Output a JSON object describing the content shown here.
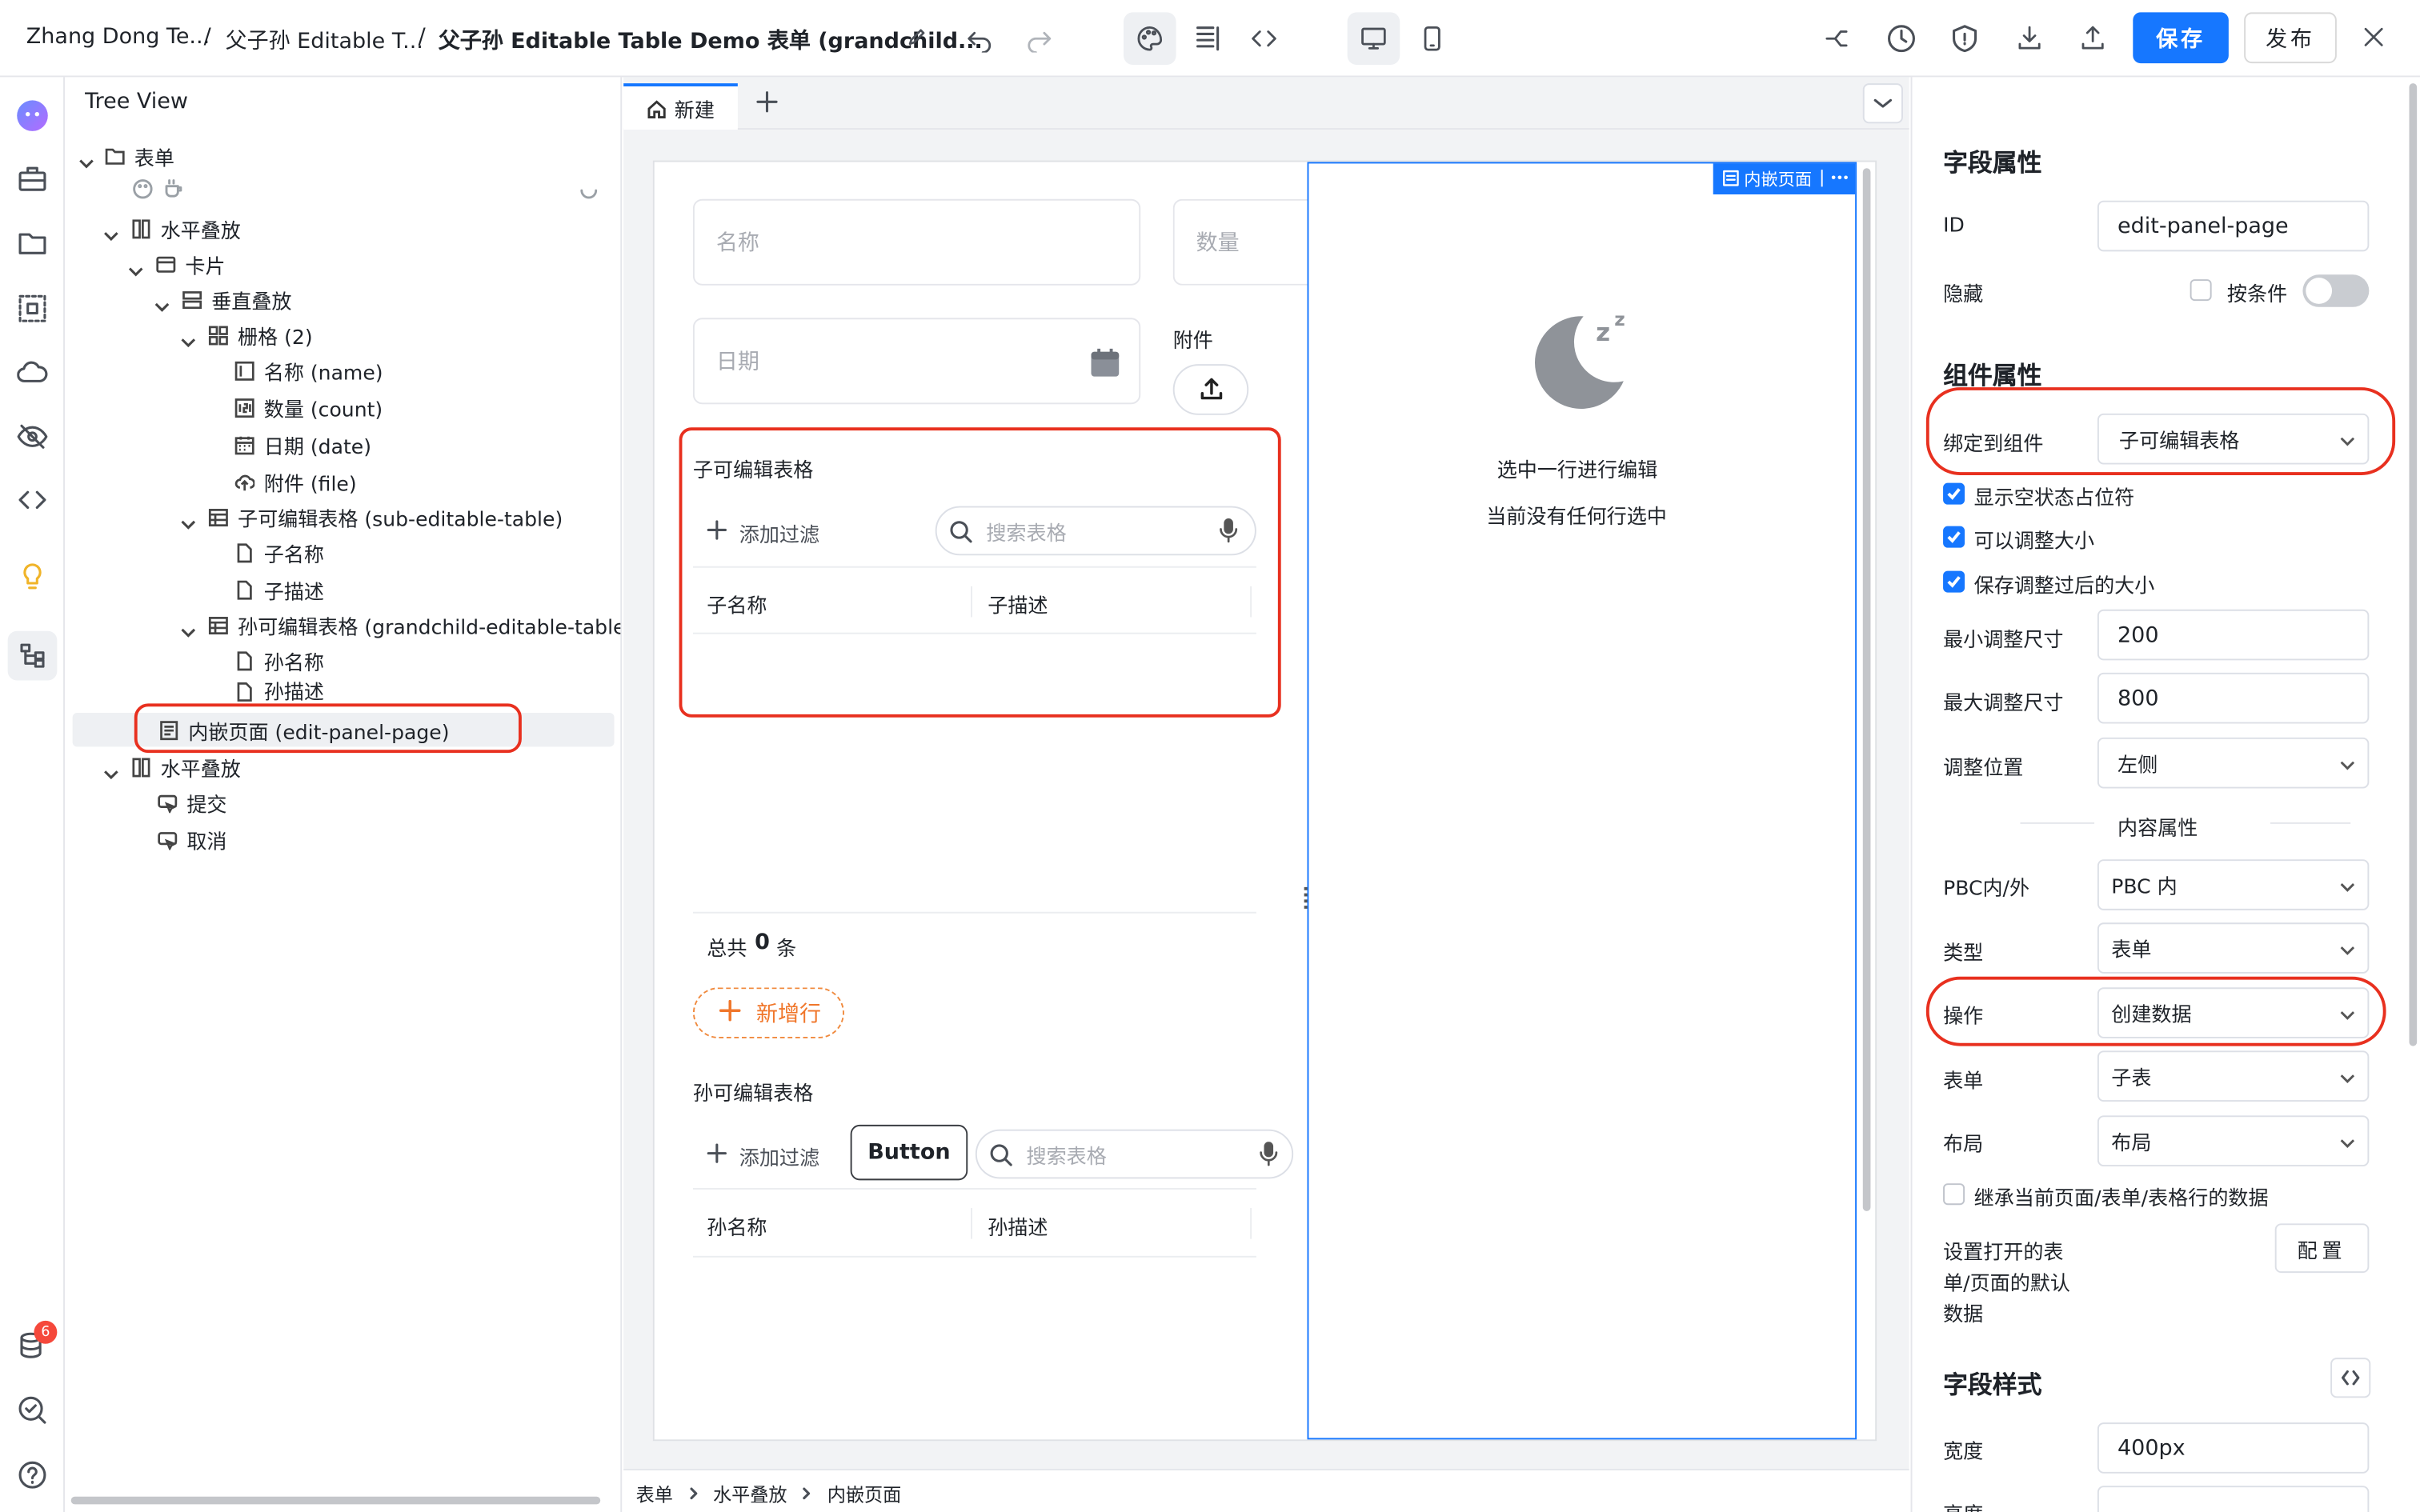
{
  "header": {
    "breadcrumbs": [
      "Zhang Dong Te...",
      "父子孙 Editable T...",
      "父子孙 Editable Table Demo 表单 (grandchild..."
    ],
    "separator": "/",
    "save_label": "保存",
    "publish_label": "发布"
  },
  "rail": {
    "badge_count": "6"
  },
  "tree": {
    "title": "Tree View",
    "nodes": [
      {
        "label": "表单",
        "icon": "folder-icon"
      },
      {
        "label": "水平叠放",
        "icon": "columns-icon"
      },
      {
        "label": "卡片",
        "icon": "card-icon"
      },
      {
        "label": "垂直叠放",
        "icon": "rows-icon"
      },
      {
        "label": "栅格 (2)",
        "icon": "grid-icon"
      },
      {
        "label": "名称 (name)",
        "icon": "text-field-icon"
      },
      {
        "label": "数量 (count)",
        "icon": "number-field-icon"
      },
      {
        "label": "日期 (date)",
        "icon": "calendar-icon"
      },
      {
        "label": "附件 (file)",
        "icon": "upload-cloud-icon"
      },
      {
        "label": "子可编辑表格 (sub-editable-table)",
        "icon": "table-icon"
      },
      {
        "label": "子名称",
        "icon": "file-icon"
      },
      {
        "label": "子描述",
        "icon": "file-icon"
      },
      {
        "label": "孙可编辑表格 (grandchild-editable-table)",
        "icon": "table-icon"
      },
      {
        "label": "孙名称",
        "icon": "file-icon"
      },
      {
        "label": "孙描述",
        "icon": "file-icon"
      },
      {
        "label": "内嵌页面 (edit-panel-page)",
        "icon": "page-icon"
      },
      {
        "label": "水平叠放",
        "icon": "columns-icon"
      },
      {
        "label": "提交",
        "icon": "button-icon"
      },
      {
        "label": "取消",
        "icon": "button-icon"
      }
    ]
  },
  "canvas": {
    "tab_label": "新建",
    "name_placeholder": "名称",
    "count_placeholder": "数量",
    "date_placeholder": "日期",
    "attachment_label": "附件",
    "sub_table": {
      "title": "子可编辑表格",
      "add_filter": "添加过滤",
      "search_placeholder": "搜索表格",
      "columns": [
        "子名称",
        "子描述"
      ]
    },
    "total_prefix": "总共",
    "total_count": "0",
    "total_suffix": "条",
    "add_row": "新增行",
    "grand_table": {
      "title": "孙可编辑表格",
      "add_filter": "添加过滤",
      "button_label": "Button",
      "search_placeholder": "搜索表格",
      "columns": [
        "孙名称",
        "孙描述"
      ]
    },
    "embed": {
      "badge": "内嵌页面",
      "empty_title": "选中一行进行编辑",
      "empty_sub": "当前没有任何行选中"
    },
    "footer_crumbs": [
      "表单",
      "水平叠放",
      "内嵌页面"
    ]
  },
  "props": {
    "field_section": "字段属性",
    "id_label": "ID",
    "id_value": "edit-panel-page",
    "hidden_label": "隐藏",
    "conditional_label": "按条件",
    "component_section": "组件属性",
    "bind_label": "绑定到组件",
    "bind_value": "子可编辑表格",
    "show_empty": "显示空状态占位符",
    "resizable": "可以调整大小",
    "save_size": "保存调整过后的大小",
    "min_label": "最小调整尺寸",
    "min_value": "200",
    "max_label": "最大调整尺寸",
    "max_value": "800",
    "pos_label": "调整位置",
    "pos_value": "左侧",
    "content_section": "内容属性",
    "pbc_label": "PBC内/外",
    "pbc_value": "PBC 内",
    "type_label": "类型",
    "type_value": "表单",
    "op_label": "操作",
    "op_value": "创建数据",
    "form_label": "表单",
    "form_value": "子表",
    "layout_label": "布局",
    "layout_value": "布局",
    "inherit_label": "继承当前页面/表单/表格行的数据",
    "default_label_1": "设置打开的表",
    "default_label_2": "单/页面的默认",
    "default_label_3": "数据",
    "config_label": "配置",
    "style_section": "字段样式",
    "width_label": "宽度",
    "width_value": "400px",
    "height_label": "高度"
  }
}
